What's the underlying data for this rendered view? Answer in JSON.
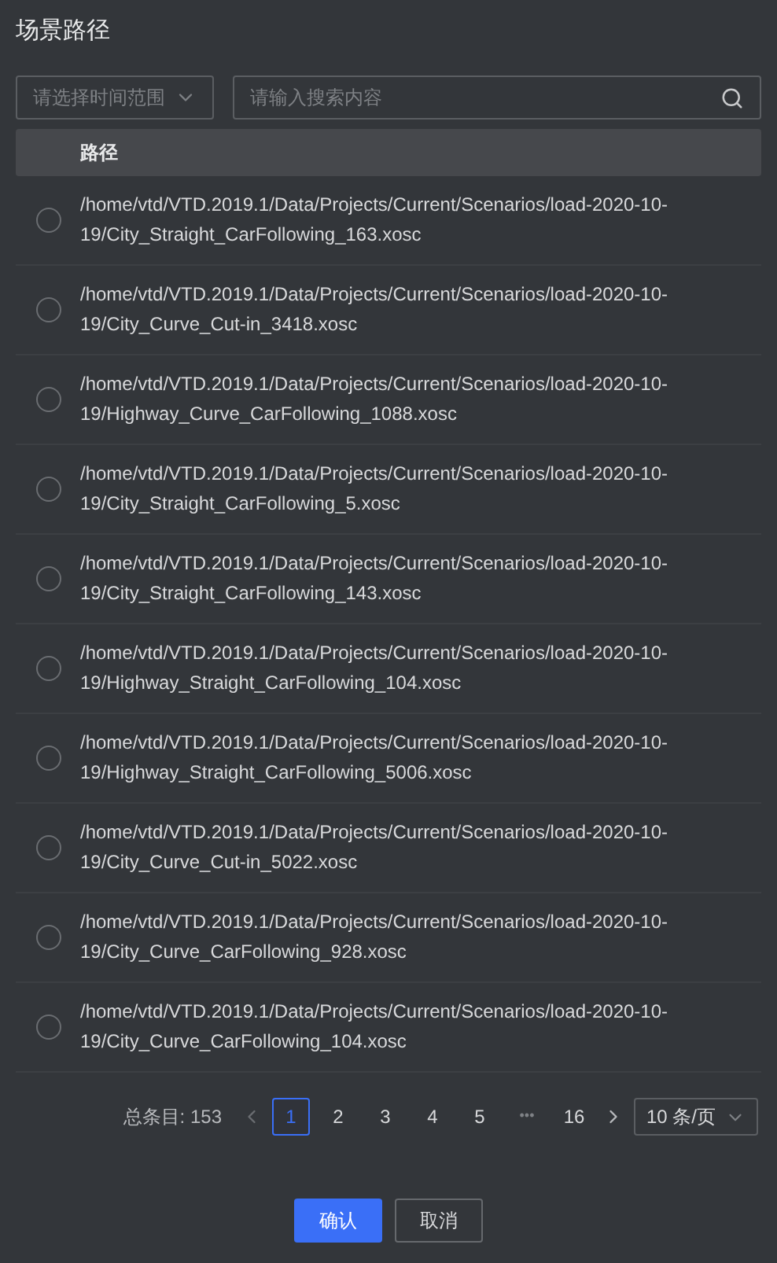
{
  "title": "场景路径",
  "time_select": {
    "placeholder": "请选择时间范围"
  },
  "search": {
    "placeholder": "请输入搜索内容"
  },
  "table": {
    "columns": [
      "路径"
    ],
    "rows": [
      {
        "path": "/home/vtd/VTD.2019.1/Data/Projects/Current/Scenarios/load-2020-10-19/City_Straight_CarFollowing_163.xosc",
        "selected": false
      },
      {
        "path": "/home/vtd/VTD.2019.1/Data/Projects/Current/Scenarios/load-2020-10-19/City_Curve_Cut-in_3418.xosc",
        "selected": false
      },
      {
        "path": "/home/vtd/VTD.2019.1/Data/Projects/Current/Scenarios/load-2020-10-19/Highway_Curve_CarFollowing_1088.xosc",
        "selected": false
      },
      {
        "path": "/home/vtd/VTD.2019.1/Data/Projects/Current/Scenarios/load-2020-10-19/City_Straight_CarFollowing_5.xosc",
        "selected": false
      },
      {
        "path": "/home/vtd/VTD.2019.1/Data/Projects/Current/Scenarios/load-2020-10-19/City_Straight_CarFollowing_143.xosc",
        "selected": false
      },
      {
        "path": "/home/vtd/VTD.2019.1/Data/Projects/Current/Scenarios/load-2020-10-19/Highway_Straight_CarFollowing_104.xosc",
        "selected": false
      },
      {
        "path": "/home/vtd/VTD.2019.1/Data/Projects/Current/Scenarios/load-2020-10-19/Highway_Straight_CarFollowing_5006.xosc",
        "selected": false
      },
      {
        "path": "/home/vtd/VTD.2019.1/Data/Projects/Current/Scenarios/load-2020-10-19/City_Curve_Cut-in_5022.xosc",
        "selected": false
      },
      {
        "path": "/home/vtd/VTD.2019.1/Data/Projects/Current/Scenarios/load-2020-10-19/City_Curve_CarFollowing_928.xosc",
        "selected": false
      },
      {
        "path": "/home/vtd/VTD.2019.1/Data/Projects/Current/Scenarios/load-2020-10-19/City_Curve_CarFollowing_104.xosc",
        "selected": false
      }
    ]
  },
  "pagination": {
    "total": "总条目: 153",
    "pages": [
      {
        "label": "1",
        "kind": "page",
        "selected": true
      },
      {
        "label": "2",
        "kind": "page",
        "selected": false
      },
      {
        "label": "3",
        "kind": "page",
        "selected": false
      },
      {
        "label": "4",
        "kind": "page",
        "selected": false
      },
      {
        "label": "5",
        "kind": "page",
        "selected": false
      },
      {
        "label": "•••",
        "kind": "ellipsis"
      },
      {
        "label": "16",
        "kind": "page",
        "selected": false
      }
    ],
    "page_size": "10 条/页"
  },
  "buttons": [
    {
      "label": "确认",
      "kind": "primary"
    },
    {
      "label": "取消",
      "kind": "secondary"
    }
  ]
}
